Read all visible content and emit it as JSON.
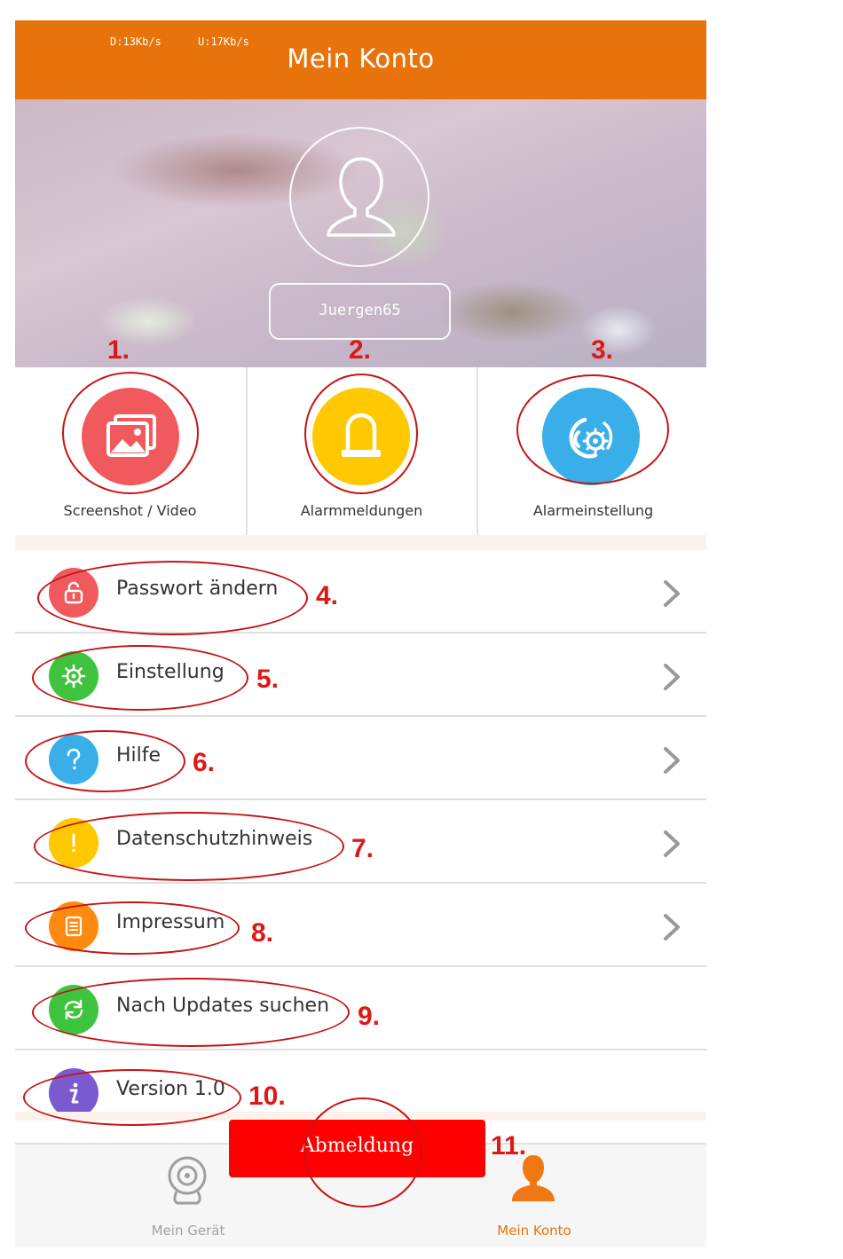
{
  "status": {
    "download": "D:13Kb/s",
    "upload": "U:17Kb/s"
  },
  "header": {
    "title": "Mein Konto"
  },
  "profile": {
    "username": "Juergen65"
  },
  "actions": [
    {
      "label": "Screenshot / Video",
      "icon": "gallery-icon",
      "color": "#f05a5c"
    },
    {
      "label": "Alarmmeldungen",
      "icon": "alarm-light-icon",
      "color": "#ffc800"
    },
    {
      "label": "Alarmeinstellung",
      "icon": "alarm-settings-icon",
      "color": "#3aaee8"
    }
  ],
  "menu": [
    {
      "label": "Passwort ändern",
      "icon": "lock-icon",
      "color": "#f05a5c",
      "chevron": true
    },
    {
      "label": "Einstellung",
      "icon": "gear-icon",
      "color": "#3fc33f",
      "chevron": true
    },
    {
      "label": "Hilfe",
      "icon": "help-icon",
      "color": "#3aaee8",
      "chevron": true
    },
    {
      "label": "Datenschutzhinweis",
      "icon": "exclamation-icon",
      "color": "#ffc800",
      "chevron": true
    },
    {
      "label": "Impressum",
      "icon": "document-icon",
      "color": "#ff8a10",
      "chevron": true
    },
    {
      "label": "Nach Updates suchen",
      "icon": "refresh-icon",
      "color": "#3fc33f",
      "chevron": false
    },
    {
      "label": "Version 1.0",
      "icon": "info-icon",
      "color": "#7b5ad0",
      "chevron": false
    }
  ],
  "logout": {
    "label": "Abmeldung"
  },
  "tabs": [
    {
      "label": "Mein Gerät",
      "icon": "camera-icon",
      "active": false
    },
    {
      "label": "Mein Konto",
      "icon": "person-icon",
      "active": true
    }
  ],
  "annotations": [
    "1.",
    "2.",
    "3.",
    "4.",
    "5.",
    "6.",
    "7.",
    "8.",
    "9.",
    "10.",
    "11."
  ],
  "colors": {
    "accent": "#e8730a",
    "annotation": "#dc1818",
    "logout": "#ff0000"
  }
}
